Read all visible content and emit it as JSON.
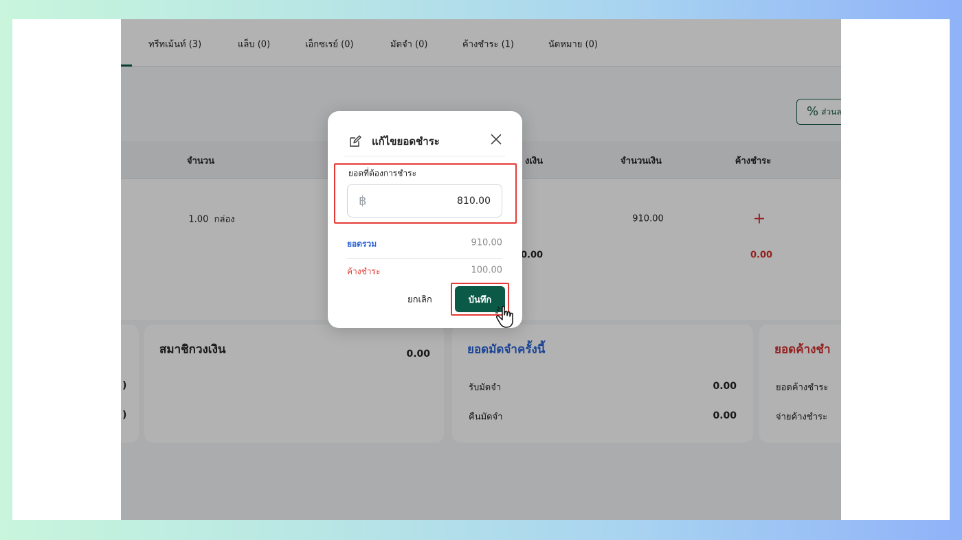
{
  "tabs": [
    {
      "label": "ทรีทเม้นท์ (3)"
    },
    {
      "label": "แล็บ (0)"
    },
    {
      "label": "เอ็กซเรย์ (0)"
    },
    {
      "label": "มัดจำ (0)"
    },
    {
      "label": "ค้างชำระ (1)"
    },
    {
      "label": "นัดหมาย (0)"
    }
  ],
  "discount_button": {
    "icon": "percent-icon",
    "label": "ส่วนล"
  },
  "table": {
    "headers": {
      "qty": "จำนวน",
      "price": "งเงิน",
      "amount": "จำนวนเงิน",
      "outstanding": "ค้างชำระ"
    },
    "row": {
      "qty": "1.00",
      "unit": "กล่อง",
      "amount": "910.00",
      "action_icon": "plus-icon"
    },
    "totals": {
      "price": "0.00",
      "outstanding": "0.00"
    }
  },
  "cards": {
    "left_partial_values": [
      ")",
      ")"
    ],
    "wallet": {
      "title": "สมาชิกวงเงิน",
      "value": "0.00"
    },
    "deposit": {
      "title": "ยอดมัดจำครั้งนี้",
      "rows": [
        {
          "label": "รับมัดจำ",
          "value": "0.00"
        },
        {
          "label": "คืนมัดจำ",
          "value": "0.00"
        }
      ]
    },
    "outstanding": {
      "title": "ยอดค้างชำ",
      "rows": [
        {
          "label": "ยอดค้างชำระ"
        },
        {
          "label": "จ่ายค้างชำระ"
        }
      ]
    }
  },
  "modal": {
    "title": "แก้ไขยอดชำระ",
    "field_label": "ยอดที่ต้องการชำระ",
    "currency_symbol": "฿",
    "amount": "810.00",
    "total_label": "ยอดรวม",
    "total_value": "910.00",
    "outstanding_label": "ค้างชำระ",
    "outstanding_value": "100.00",
    "cancel_label": "ยกเลิก",
    "save_label": "บันทึก"
  },
  "colors": {
    "brand": "#0b5a47",
    "highlight": "#e53935",
    "total_blue": "#2962d6",
    "outstanding_red": "#d32f2f"
  }
}
